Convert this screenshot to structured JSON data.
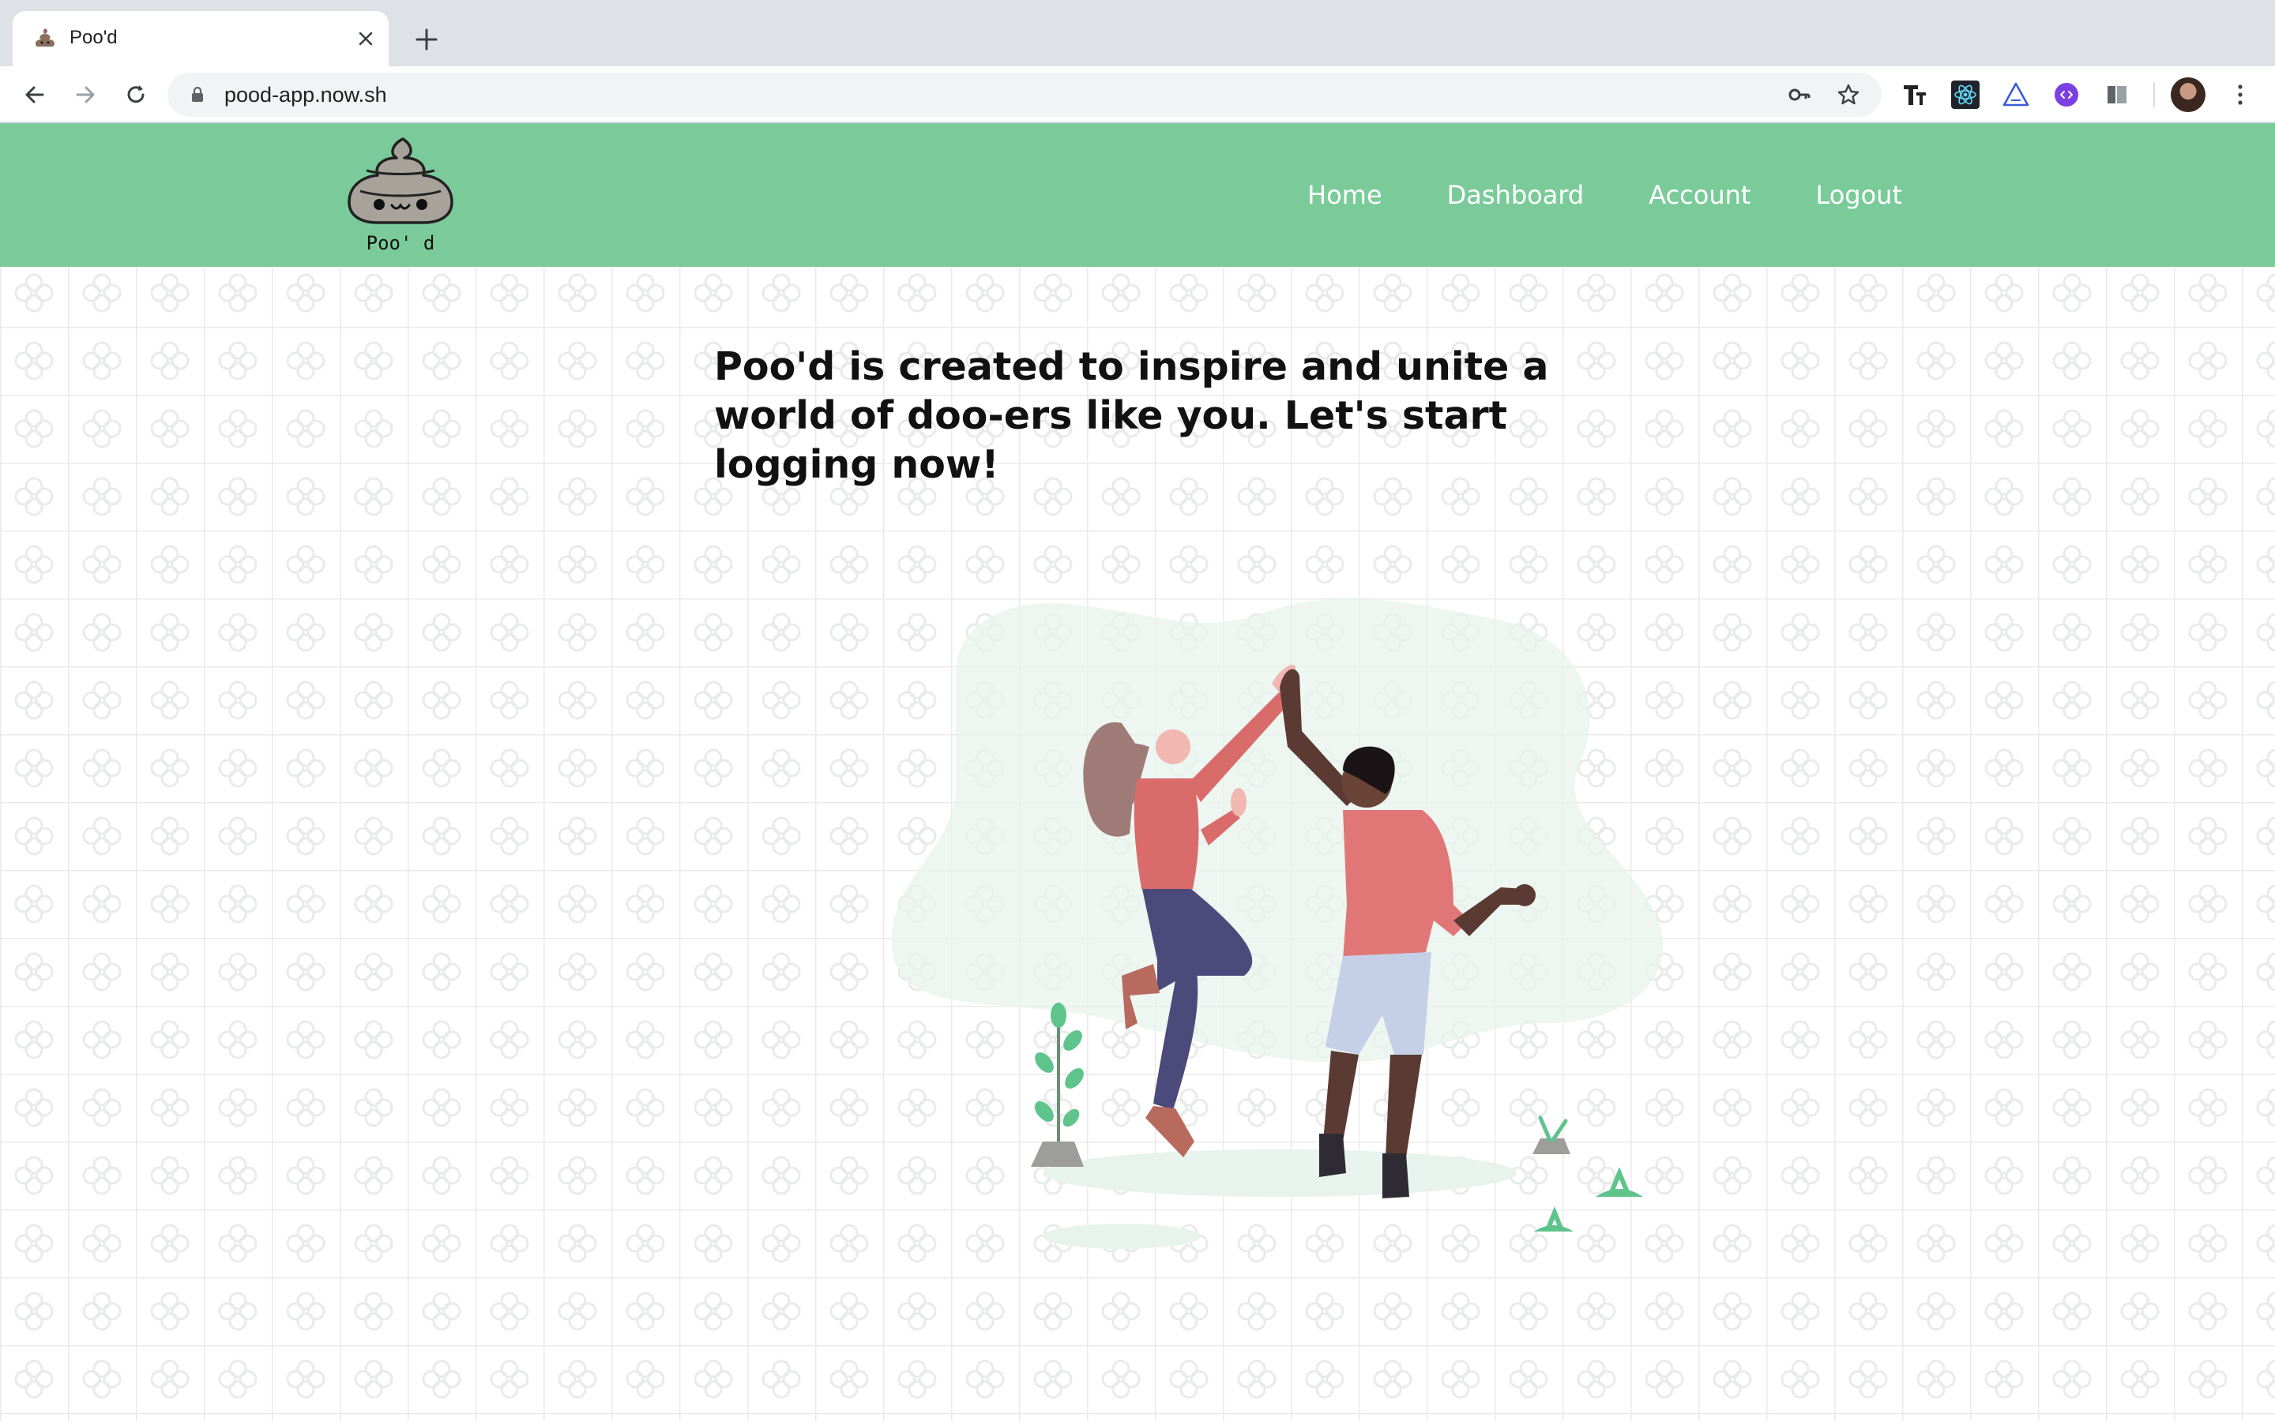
{
  "browser": {
    "tab_title": "Poo'd",
    "url": "pood-app.now.sh"
  },
  "navbar": {
    "logo_text": "Poo' d",
    "links": [
      {
        "label": "Home"
      },
      {
        "label": "Dashboard"
      },
      {
        "label": "Account"
      },
      {
        "label": "Logout"
      }
    ],
    "background_color": "#7bcb9a"
  },
  "main": {
    "headline": "Poo'd is created to inspire and unite a world of doo-ers like you. Let's start logging now!"
  }
}
